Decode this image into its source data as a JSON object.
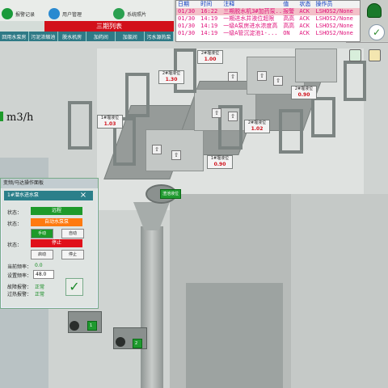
{
  "toolbar": {
    "items": [
      {
        "label": "报警记录",
        "icon": "alarm-record-icon",
        "color": "#1a9a3a"
      },
      {
        "label": "用户管理",
        "icon": "user-icon",
        "color": "#2a8ad0"
      },
      {
        "label": "系统照片",
        "icon": "gear-icon",
        "color": "#2aa050"
      }
    ],
    "phase_list": "三期列表"
  },
  "nav": [
    "回用水泵房",
    "污泥浓缩池",
    "脱水机房",
    "加药间",
    "加氯间",
    "污水源热泵"
  ],
  "alarm": {
    "headers": [
      "日期",
      "时间",
      "注释",
      "值",
      "状态",
      "操作员"
    ],
    "rows": [
      [
        "01/30",
        "16:22",
        "三期脱水机3#加药泵...",
        "报警",
        "ACK",
        "LSHOS2/None"
      ],
      [
        "01/30",
        "14:19",
        "一期进水井液位超限",
        "高高",
        "ACK",
        "LSHOS2/None"
      ],
      [
        "01/30",
        "14:19",
        "一级A泵房进水浓度高",
        "高高",
        "ACK",
        "LSHOS2/None"
      ],
      [
        "01/30",
        "14:19",
        "一级A管沉淀池1-...",
        "ON",
        "ACK",
        "LSHOS2/None"
      ]
    ]
  },
  "flow_unit": "m3/h",
  "gates": [
    {
      "label": "2#堰液位",
      "value": "1.00"
    },
    {
      "label": "2#堰液位",
      "value": "1.30"
    },
    {
      "label": "1#堰液位",
      "value": "1.03"
    },
    {
      "label": "2#堰液位",
      "value": "0.90"
    },
    {
      "label": "2#堰液位",
      "value": "1.02"
    },
    {
      "label": "1#堰液位",
      "value": "0.90"
    }
  ],
  "tags": [
    "渣池液位",
    "1",
    "2"
  ],
  "panel": {
    "title": "变频/马达操作面板",
    "subtitle": "1#潜水进水泵",
    "close": "×",
    "status_label": "状态：",
    "state1": "远程",
    "state2": "自动水泵泵",
    "btn_manual": "手动",
    "btn_auto": "自动",
    "state3": "停止",
    "btn_start": "启动",
    "btn_stop": "停止",
    "cur_freq_label": "当前频率：",
    "cur_freq": "0.0",
    "set_freq_label": "设置频率：",
    "set_freq": "48.0",
    "fault_label": "故障报警：",
    "fault_value": "正常",
    "overload_label": "过热报警：",
    "overload_value": "正常",
    "colors": {
      "remote": "#1e9a2a",
      "auto": "#ff7a10",
      "stop": "#e0101a"
    }
  }
}
